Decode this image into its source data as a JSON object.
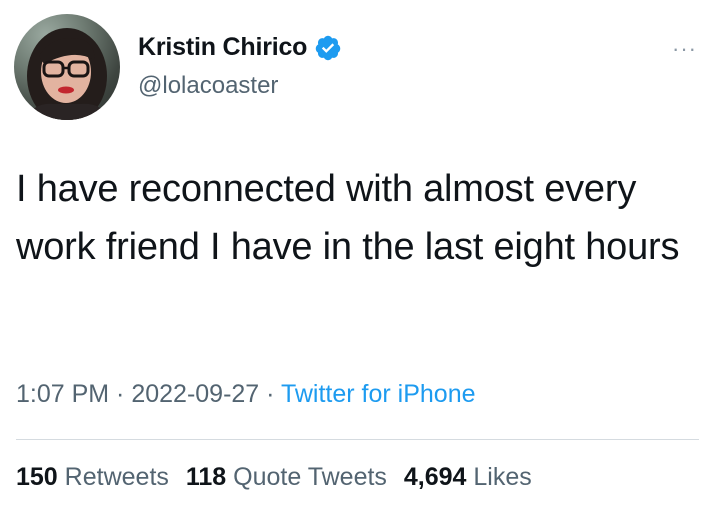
{
  "user": {
    "display_name": "Kristin Chirico",
    "handle": "@lolacoaster",
    "verified_icon": "verified-badge-icon",
    "verified_color": "#1d9bf0"
  },
  "menu": {
    "more_label": "···"
  },
  "tweet": {
    "text": "I have reconnected with almost every work friend I have in the last eight hours",
    "time": "1:07 PM",
    "separator1": " · ",
    "date": "2022-09-27",
    "separator2": " · ",
    "source": "Twitter for iPhone"
  },
  "stats": {
    "retweets_count": "150",
    "retweets_label": "Retweets",
    "quotes_count": "118",
    "quotes_label": "Quote Tweets",
    "likes_count": "4,694",
    "likes_label": "Likes"
  },
  "colors": {
    "text_primary": "#0f1419",
    "text_secondary": "#536471",
    "accent": "#1d9bf0"
  }
}
